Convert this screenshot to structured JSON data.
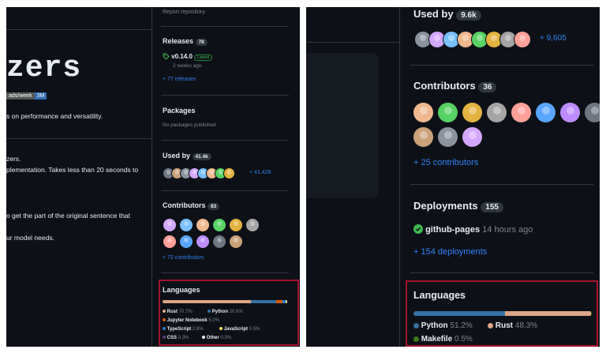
{
  "colors": {
    "rust": "#dea584",
    "python": "#3572A5",
    "jupyter": "#DA5B0B",
    "typescript": "#3178c6",
    "javascript": "#f1e05a",
    "css": "#563d7c",
    "other": "#ededed",
    "makefile": "#427819",
    "highlight": "#a3142d"
  },
  "left": {
    "report_link": "Report repository",
    "repo_title_fragment": "zers",
    "downloads_badge": {
      "label": "ads/week",
      "value": "3M"
    },
    "readme_lines": [
      "s on performance and versatility.",
      "zers.",
      "plementation. Takes less than 20 seconds to",
      "o get the part of the original sentence that",
      "ur model needs."
    ],
    "releases": {
      "heading": "Releases",
      "count": "78",
      "tag": "v0.14.0",
      "latest_badge": "Latest",
      "time": "2 weeks ago",
      "more": "+ 77 releases"
    },
    "packages": {
      "heading": "Packages",
      "empty": "No packages published"
    },
    "used_by": {
      "heading": "Used by",
      "count": "41.4k",
      "more": "+ 41,428"
    },
    "contributors": {
      "heading": "Contributors",
      "count": "83",
      "more": "+ 72 contributors"
    },
    "languages": {
      "heading": "Languages",
      "items": [
        {
          "name": "Rust",
          "pct": "70.7%",
          "value": 70.7,
          "color": "#dea584"
        },
        {
          "name": "Python",
          "pct": "20.6%",
          "value": 20.6,
          "color": "#3572A5"
        },
        {
          "name": "Jupyter Notebook",
          "pct": "5.0%",
          "value": 5.0,
          "color": "#DA5B0B"
        },
        {
          "name": "TypeScript",
          "pct": "2.6%",
          "value": 2.6,
          "color": "#3178c6"
        },
        {
          "name": "JavaScript",
          "pct": "0.5%",
          "value": 0.5,
          "color": "#f1e05a"
        },
        {
          "name": "CSS",
          "pct": "0.3%",
          "value": 0.3,
          "color": "#563d7c"
        },
        {
          "name": "Other",
          "pct": "0.3%",
          "value": 0.3,
          "color": "#ededed"
        }
      ]
    }
  },
  "right": {
    "used_by": {
      "heading": "Used by",
      "count": "9.6k",
      "more": "+ 9,605"
    },
    "contributors": {
      "heading": "Contributors",
      "count": "36",
      "more": "+ 25 contributors"
    },
    "deployments": {
      "heading": "Deployments",
      "count": "155",
      "env": "github-pages",
      "time": "14 hours ago",
      "more": "+ 154 deployments"
    },
    "languages": {
      "heading": "Languages",
      "items": [
        {
          "name": "Python",
          "pct": "51.2%",
          "value": 51.2,
          "color": "#3572A5"
        },
        {
          "name": "Rust",
          "pct": "48.3%",
          "value": 48.3,
          "color": "#dea584"
        },
        {
          "name": "Makefile",
          "pct": "0.5%",
          "value": 0.5,
          "color": "#427819"
        }
      ]
    }
  }
}
